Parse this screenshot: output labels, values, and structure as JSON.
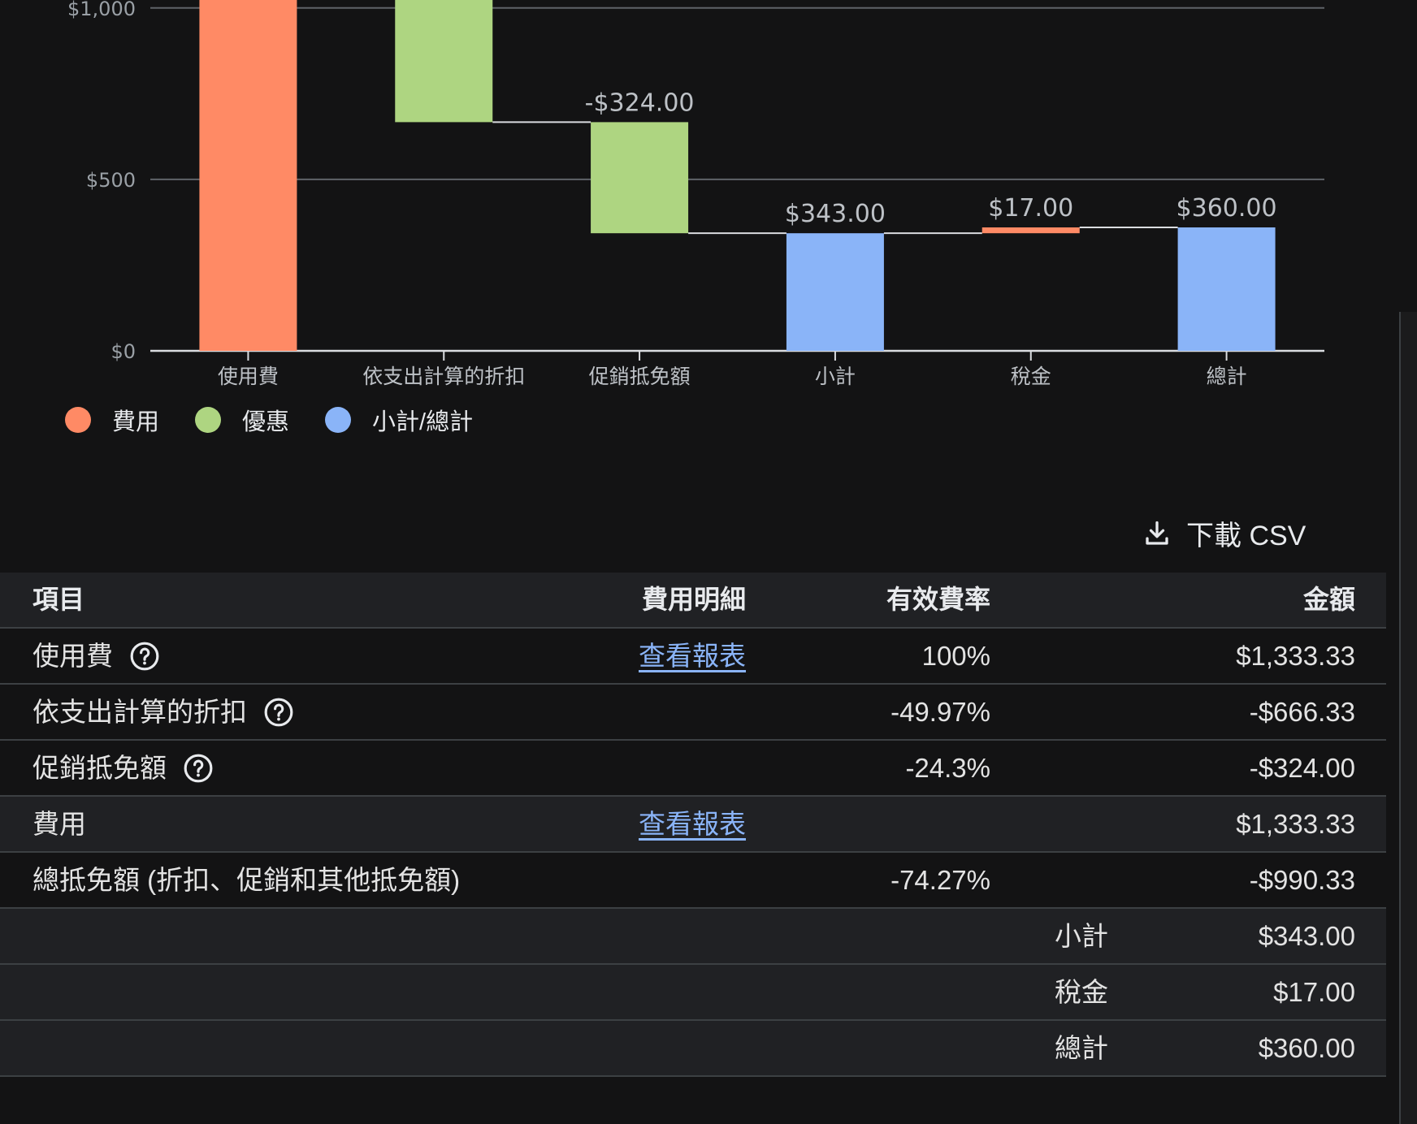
{
  "colors": {
    "fee": "#ff8a65",
    "discount": "#aed581",
    "total": "#8ab4f8",
    "link": "#8ab4f8"
  },
  "chart_data": {
    "type": "bar",
    "subtype": "waterfall",
    "categories": [
      "使用費",
      "依支出計算的折扣",
      "促銷抵免額",
      "小計",
      "稅金",
      "總計"
    ],
    "y_ticks": [
      "$0",
      "$500",
      "$1,000"
    ],
    "ylim": [
      0,
      1000
    ],
    "grid": true,
    "bars": [
      {
        "category": "使用費",
        "start": 0,
        "end": 1333.33,
        "kind": "fee",
        "label": ""
      },
      {
        "category": "依支出計算的折扣",
        "start": 1333.33,
        "end": 667.0,
        "kind": "discount",
        "label": ""
      },
      {
        "category": "促銷抵免額",
        "start": 667.0,
        "end": 343.0,
        "kind": "discount",
        "label": "-$324.00"
      },
      {
        "category": "小計",
        "start": 0,
        "end": 343.0,
        "kind": "total",
        "label": "$343.00"
      },
      {
        "category": "稅金",
        "start": 343.0,
        "end": 360.0,
        "kind": "fee",
        "label": "$17.00"
      },
      {
        "category": "總計",
        "start": 0,
        "end": 360.0,
        "kind": "total",
        "label": "$360.00"
      }
    ],
    "legend": [
      {
        "name": "費用",
        "kind": "fee"
      },
      {
        "name": "優惠",
        "kind": "discount"
      },
      {
        "name": "小計/總計",
        "kind": "total"
      }
    ],
    "legend_position": "bottom-left"
  },
  "download": {
    "label": "下載 CSV",
    "icon": "download-icon"
  },
  "table": {
    "headers": {
      "item": "項目",
      "detail": "費用明細",
      "rate": "有效費率",
      "amount": "金額"
    },
    "rows": [
      {
        "item": "使用費",
        "help": true,
        "detail": "查看報表",
        "rate": "100%",
        "amount": "$1,333.33"
      },
      {
        "item": "依支出計算的折扣",
        "help": true,
        "detail": "",
        "rate": "-49.97%",
        "amount": "-$666.33"
      },
      {
        "item": "促銷抵免額",
        "help": true,
        "detail": "",
        "rate": "-24.3%",
        "amount": "-$324.00"
      },
      {
        "item": "費用",
        "help": false,
        "detail": "查看報表",
        "rate": "",
        "amount": "$1,333.33"
      },
      {
        "item": "總抵免額 (折扣、促銷和其他抵免額)",
        "help": false,
        "detail": "",
        "rate": "-74.27%",
        "amount": "-$990.33"
      }
    ],
    "summary": [
      {
        "label": "小計",
        "amount": "$343.00"
      },
      {
        "label": "稅金",
        "amount": "$17.00"
      },
      {
        "label": "總計",
        "amount": "$360.00"
      }
    ]
  }
}
